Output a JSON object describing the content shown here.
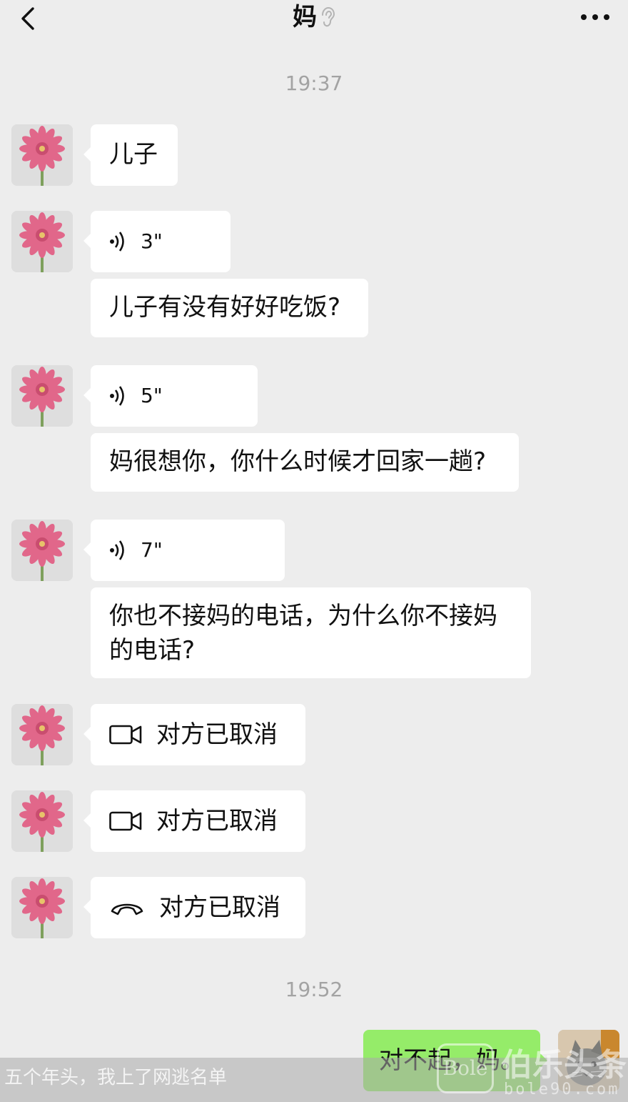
{
  "header": {
    "title": "妈",
    "back_icon": "chevron-left-icon",
    "mute_icon": "ear-icon",
    "more_icon": "more-dots-icon"
  },
  "timestamps": [
    "19:37",
    "19:52"
  ],
  "messages": [
    {
      "type": "text",
      "text": "儿子"
    },
    {
      "type": "voice",
      "duration": "3\""
    },
    {
      "type": "text",
      "text": "儿子有没有好好吃饭?"
    },
    {
      "type": "voice",
      "duration": "5\""
    },
    {
      "type": "text",
      "text": "妈很想你，你什么时候才回家一趟?"
    },
    {
      "type": "voice",
      "duration": "7\""
    },
    {
      "type": "text",
      "lines": [
        "你也不接妈的电话，为什么你不接妈",
        "的电话?"
      ]
    },
    {
      "type": "video-call",
      "text": "对方已取消"
    },
    {
      "type": "video-call",
      "text": "对方已取消"
    },
    {
      "type": "voice-call",
      "text": "对方已取消"
    },
    {
      "type": "text",
      "sender": "me",
      "text": "对不起，妈。"
    }
  ],
  "caption": "五个年头，我上了网逃名单",
  "watermark": {
    "logo": "Bole",
    "cn": "伯乐头条",
    "site": "bole90.com"
  },
  "colors": {
    "background": "#ededed",
    "bubble_in": "#ffffff",
    "bubble_out": "#95ec69",
    "timestamp": "#a3a3a3"
  }
}
